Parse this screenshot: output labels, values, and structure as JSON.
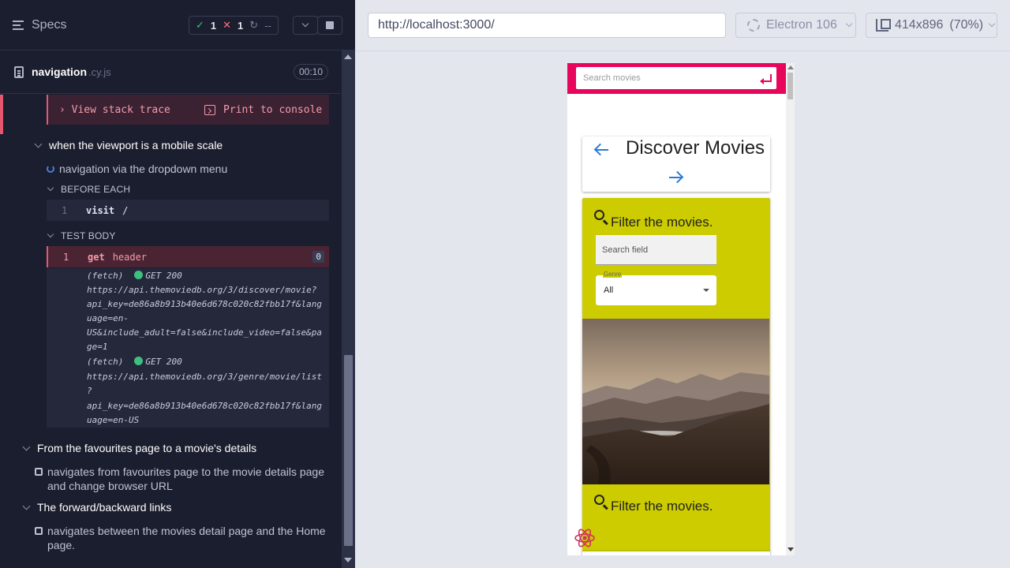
{
  "reporter": {
    "title": "Specs",
    "stats": {
      "passed": "1",
      "failed": "1",
      "pending": "--"
    },
    "file": {
      "name": "navigation",
      "ext": ".cy.js",
      "duration": "00:10"
    },
    "stack_trace_label": "View stack trace",
    "print_label": "Print to console",
    "suites": [
      {
        "title": "when the viewport is a mobile scale"
      },
      {
        "title": "From the favourites page to a movie's details"
      },
      {
        "title": "The forward/backward links"
      }
    ],
    "running_test": "navigation via the dropdown menu",
    "before_each_label": "BEFORE EACH",
    "test_body_label": "TEST BODY",
    "commands": [
      {
        "num": "1",
        "name": "visit",
        "msg": "/"
      },
      {
        "num": "1",
        "name": "get",
        "msg": "header",
        "badge": "0"
      }
    ],
    "logs": [
      "(fetch)",
      "GET 200",
      "https://api.themoviedb.org/3/discover/movie?",
      "api_key=de86a8b913b40e6d678c020c82fbb17f&lang",
      "uage=en-",
      "US&include_adult=false&include_video=false&pa",
      "ge=1",
      "(fetch)",
      "GET 200",
      "https://api.themoviedb.org/3/genre/movie/list",
      "?",
      "api_key=de86a8b913b40e6d678c020c82fbb17f&lang",
      "uage=en-US"
    ],
    "pending_tests": [
      "navigates from favourites page to the movie details page and change browser URL",
      "navigates between the movies detail page and the Home page."
    ]
  },
  "aut": {
    "url": "http://localhost:3000/",
    "browser": "Electron 106",
    "viewport": "414x896",
    "zoom": "(70%)",
    "app": {
      "search_placeholder": "Search movies",
      "page_title": "Discover Movies",
      "filter_title": "Filter the movies.",
      "search_field_placeholder": "Search field",
      "genre_label": "Genre",
      "genre_value": "All",
      "filter_title_2": "Filter the movies."
    }
  },
  "colors": {
    "app_bar": "#e8065c",
    "filter_card": "#cccc00",
    "nav_arrow": "#2a7bd6",
    "pass": "#3fbf7f",
    "fail": "#e45770"
  }
}
